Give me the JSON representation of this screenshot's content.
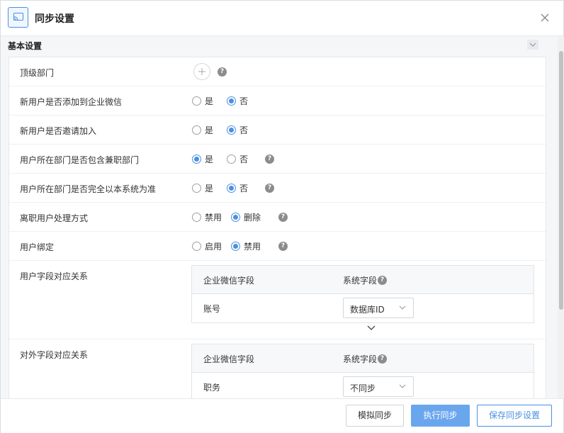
{
  "dialog": {
    "title": "同步设置",
    "close_icon": "close-icon"
  },
  "section": {
    "title": "基本设置"
  },
  "rows": {
    "top_dept": {
      "label": "顶级部门",
      "help": "?"
    },
    "add_to_wechat": {
      "label": "新用户是否添加到企业微信",
      "options": [
        "是",
        "否"
      ],
      "selected": "否"
    },
    "invite": {
      "label": "新用户是否邀请加入",
      "options": [
        "是",
        "否"
      ],
      "selected": "否"
    },
    "part_time": {
      "label": "用户所在部门是否包含兼职部门",
      "options": [
        "是",
        "否"
      ],
      "selected": "是",
      "help": "?"
    },
    "system_standard": {
      "label": "用户所在部门是否完全以本系统为准",
      "options": [
        "是",
        "否"
      ],
      "selected": "否",
      "help": "?"
    },
    "resigned": {
      "label": "离职用户处理方式",
      "options": [
        "禁用",
        "删除"
      ],
      "selected": "删除",
      "help": "?"
    },
    "binding": {
      "label": "用户绑定",
      "options": [
        "启用",
        "禁用"
      ],
      "selected": "禁用",
      "help": "?"
    },
    "user_fields": {
      "label": "用户字段对应关系",
      "headers": [
        "企业微信字段",
        "系统字段"
      ],
      "help": "?",
      "rows": [
        {
          "field": "账号",
          "value": "数据库ID"
        }
      ]
    },
    "external_fields": {
      "label": "对外字段对应关系",
      "headers": [
        "企业微信字段",
        "系统字段"
      ],
      "help": "?",
      "rows": [
        {
          "field": "职务",
          "value": "不同步"
        }
      ]
    }
  },
  "footer": {
    "simulate_label": "模拟同步",
    "execute_label": "执行同步",
    "save_label": "保存同步设置"
  },
  "colors": {
    "accent": "#4a90e2",
    "primary_button": "#6aa6ee"
  }
}
